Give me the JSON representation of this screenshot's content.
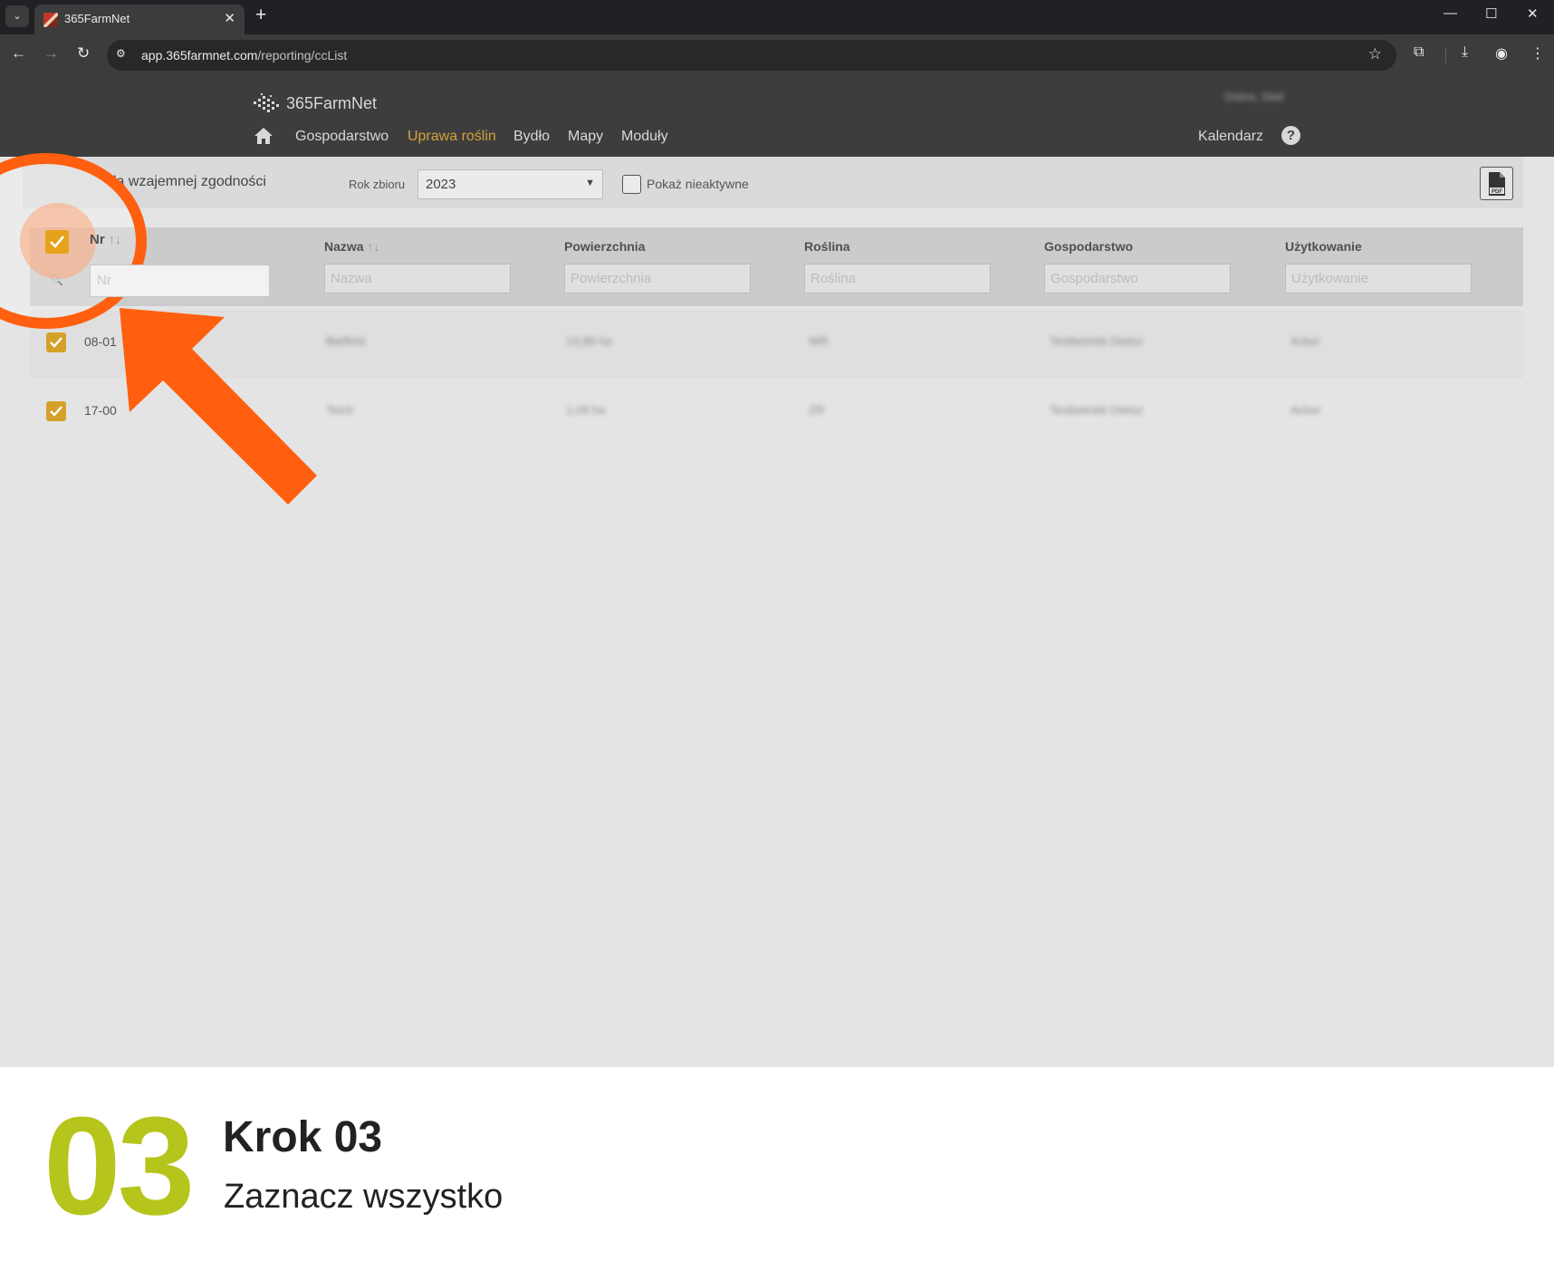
{
  "browser": {
    "tab_title": "365FarmNet",
    "url_host": "app.365farmnet.com",
    "url_path": "/reporting/ccList"
  },
  "header": {
    "logo_text": "365FarmNet",
    "user_name": "Online, Dietl",
    "nav": [
      "Gospodarstwo",
      "Uprawa roślin",
      "Bydło",
      "Mapy",
      "Moduły"
    ],
    "active_nav": "Uprawa roślin",
    "calendar_label": "Kalendarz",
    "accent_color": "#d4a23a"
  },
  "filters": {
    "report_title": "la wzajemnej zgodności",
    "year_label": "Rok zbioru",
    "year_value": "2023",
    "inactive_label": "Pokaż nieaktywne",
    "inactive_checked": false
  },
  "table": {
    "columns": [
      {
        "label": "Nr",
        "placeholder": "Nr",
        "sortable": true
      },
      {
        "label": "Nazwa",
        "placeholder": "Nazwa",
        "sortable": true
      },
      {
        "label": "Powierzchnia",
        "placeholder": "Powierzchnia"
      },
      {
        "label": "Roślina",
        "placeholder": "Roślina"
      },
      {
        "label": "Gospodarstwo",
        "placeholder": "Gospodarstwo"
      },
      {
        "label": "Użytkowanie",
        "placeholder": "Użytkowanie"
      }
    ],
    "sort_arrows": "↑↓",
    "all_selected": true,
    "rows": [
      {
        "nr": "08-01",
        "name": "Bielfeld",
        "area": "13,89 ha",
        "crop": "WR",
        "farm": "Testbetrieb Dietsz",
        "usage": "Acker",
        "selected": true
      },
      {
        "nr": "17-00",
        "name": "Teich",
        "area": "1,09 ha",
        "crop": "ZR",
        "farm": "Testbetrieb Dietsz",
        "usage": "Acker",
        "selected": true
      }
    ]
  },
  "highlight_color": "#ff5f0f",
  "step": {
    "number": "03",
    "title": "Krok 03",
    "description": "Zaznacz wszystko",
    "number_color": "#b5c51b"
  }
}
